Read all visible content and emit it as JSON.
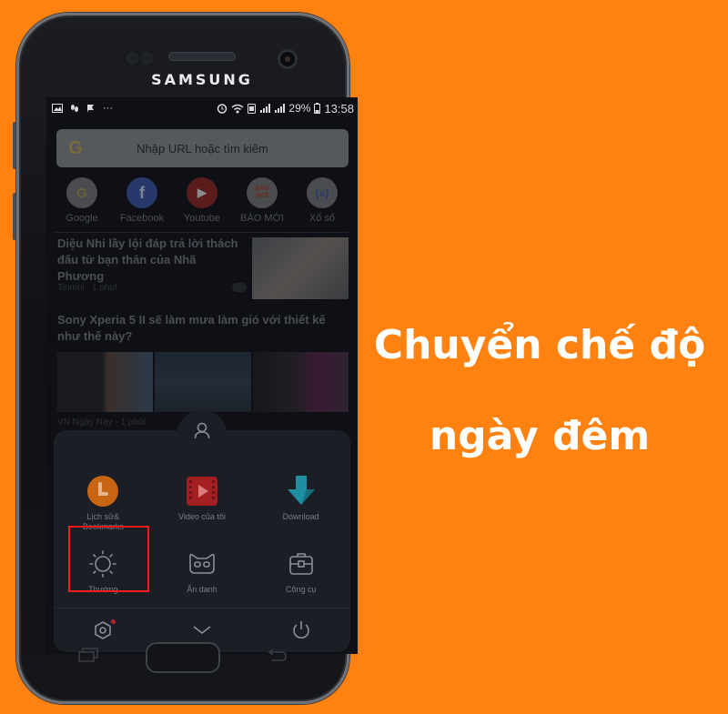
{
  "phone": {
    "brand": "SAMSUNG"
  },
  "statusbar": {
    "left_icons": [
      "gallery-icon",
      "footprint-icon",
      "flag-icon",
      "more-icon"
    ],
    "more": "···",
    "battery_percent": "29%",
    "time": "13:58"
  },
  "browser": {
    "search": {
      "placeholder": "Nhập URL hoặc tìm kiếm",
      "engine_icon": "G"
    },
    "shortcuts": [
      {
        "label": "Google",
        "glyph": "G",
        "bg": "#4a4c50",
        "fg": "#6a5d35"
      },
      {
        "label": "Facebook",
        "glyph": "f",
        "bg": "#26396a",
        "fg": "#7d8595"
      },
      {
        "label": "Youtube",
        "glyph": "▶",
        "bg": "#5b1c1c",
        "fg": "#8c8c8c"
      },
      {
        "label": "BÁO MỚI",
        "glyph": "BÁO MỚI",
        "bg": "#4a4c50",
        "fg": "#6b2a1a"
      },
      {
        "label": "Xổ số",
        "glyph": "(x)",
        "bg": "#4a4c50",
        "fg": "#2a3a6a"
      }
    ],
    "news": [
      {
        "title": "Diệu Nhi lầy lội đáp trả lời thách đấu từ bạn thân của Nhã Phương",
        "source": "Tinmoi",
        "time": "1 phút"
      },
      {
        "title": "Sony Xperia 5 II sẽ làm mưa làm gió với thiết kế như thế này?",
        "source": "VN Ngày Nay",
        "time": "1 phút"
      }
    ]
  },
  "menu": {
    "items": [
      {
        "label": "Lịch sử& Bookmarks",
        "icon": "clock-icon",
        "color": "#c76512"
      },
      {
        "label": "Video của tôi",
        "icon": "video-icon",
        "color": "#a41f22"
      },
      {
        "label": "Download",
        "icon": "download-arrow-icon",
        "color": "#1f8ea0"
      },
      {
        "label": "Thường",
        "icon": "sun-icon",
        "color": "#8a8e96"
      },
      {
        "label": "Ẩn danh",
        "icon": "mask-icon",
        "color": "#8a8e96"
      },
      {
        "label": "Công cụ",
        "icon": "toolbox-icon",
        "color": "#8a8e96"
      }
    ],
    "highlighted": "Thường",
    "bottom_bar": [
      "settings-icon",
      "chevron-down-icon",
      "power-icon"
    ],
    "settings_badge": true
  },
  "caption": {
    "line1": "Chuyển chế độ",
    "line2": "ngày đêm"
  },
  "colors": {
    "background": "#ff8210",
    "highlight": "#ff1a1a",
    "caption": "#ffffff"
  }
}
